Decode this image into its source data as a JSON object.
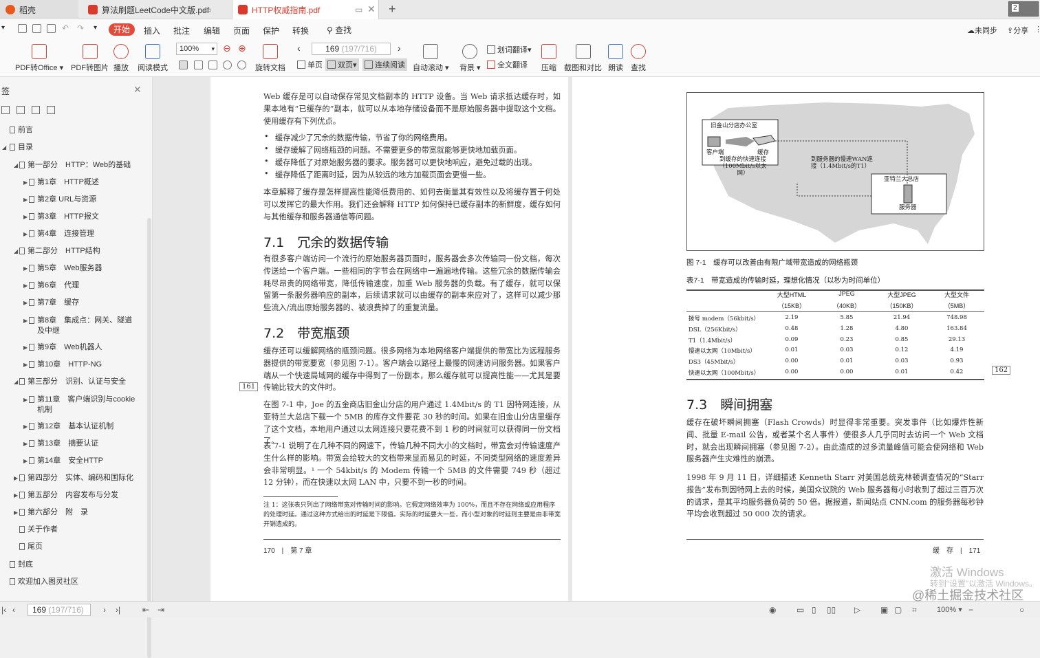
{
  "tabs": [
    {
      "label": "稻壳"
    },
    {
      "label": "算法刷题LeetCode中文版.pdf"
    },
    {
      "label": "HTTP权威指南.pdf"
    }
  ],
  "thumbnail_badge": "2",
  "menu": {
    "start": "开始",
    "items": [
      "插入",
      "批注",
      "编辑",
      "页面",
      "保护",
      "转换"
    ],
    "search": "查找",
    "sync": "未同步",
    "share": "分享"
  },
  "ribbon": {
    "pdf_to_office": "PDF转Office",
    "pdf_to_image": "PDF转图片",
    "play": "播放",
    "reading_mode": "阅读模式",
    "zoom": "100%",
    "rotate": "旋转文档",
    "page_current": "169",
    "page_total": "(197/716)",
    "single": "单页",
    "double": "双页",
    "continuous": "连续阅读",
    "auto_scroll": "自动滚动",
    "background": "背景",
    "word_translate": "划词翻译",
    "full_translate": "全文翻译",
    "compress": "压缩",
    "screenshot_compare": "截图和对比",
    "read_aloud": "朗读",
    "find": "查找"
  },
  "sidebar": {
    "title": "签",
    "toc": [
      {
        "label": "前言",
        "level": 0
      },
      {
        "label": "目录",
        "level": 0
      },
      {
        "label": "第一部分　HTTP：Web的基础",
        "level": 1
      },
      {
        "label": "第1章　HTTP概述",
        "level": 2
      },
      {
        "label": "第2章 URL与资源",
        "level": 2
      },
      {
        "label": "第3章　HTTP报文",
        "level": 2
      },
      {
        "label": "第4章　连接管理",
        "level": 2
      },
      {
        "label": "第二部分　HTTP结构",
        "level": 1
      },
      {
        "label": "第5章　Web服务器",
        "level": 2
      },
      {
        "label": "第6章　代理",
        "level": 2
      },
      {
        "label": "第7章　缓存",
        "level": 2
      },
      {
        "label": "第8章　集成点：网关、隧道及中继",
        "level": 2
      },
      {
        "label": "第9章　Web机器人",
        "level": 2
      },
      {
        "label": "第10章　HTTP-NG",
        "level": 2
      },
      {
        "label": "第三部分　识别、认证与安全",
        "level": 1
      },
      {
        "label": "第11章　客户端识别与cookie机制",
        "level": 2
      },
      {
        "label": "第12章　基本认证机制",
        "level": 2
      },
      {
        "label": "第13章　摘要认证",
        "level": 2
      },
      {
        "label": "第14章　安全HTTP",
        "level": 2
      },
      {
        "label": "第四部分　实体、编码和国际化",
        "level": 1
      },
      {
        "label": "第五部分　内容发布与分发",
        "level": 1
      },
      {
        "label": "第六部分　附　录",
        "level": 1
      },
      {
        "label": "关于作者",
        "level": 1
      },
      {
        "label": "尾页",
        "level": 1
      },
      {
        "label": "封底",
        "level": 0
      },
      {
        "label": "欢迎加入图灵社区",
        "level": 0
      }
    ]
  },
  "left_page": {
    "intro": "Web 缓存是可以自动保存常见文档副本的 HTTP 设备。当 Web 请求抵达缓存时，如果本地有“已缓存的”副本，就可以从本地存储设备而不是原始服务器中提取这个文档。使用缓存有下列优点。",
    "bullets": [
      "缓存减少了冗余的数据传输，节省了你的网络费用。",
      "缓存缓解了网络瓶颈的问题。不需要更多的带宽就能够更快地加载页面。",
      "缓存降低了对原始服务器的要求。服务器可以更快地响应，避免过载的出现。",
      "缓存降低了距离时延，因为从较远的地方加载页面会更慢一些。"
    ],
    "para2": "本章解释了缓存是怎样提高性能降低费用的、如何去衡量其有效性以及将缓存置于何处可以发挥它的最大作用。我们还会解释 HTTP 如何保持已缓存副本的新鲜度，缓存如何与其他缓存和服务器通信等问题。",
    "h71": "7.1　冗余的数据传输",
    "para3": "有很多客户端访问一个流行的原始服务器页面时，服务器会多次传输同一份文档，每次传送给一个客户端。一些相同的字节会在网络中一遍遍地传输。这些冗余的数据传输会耗尽昂贵的网络带宽，降低传输速度，加重 Web 服务器的负载。有了缓存，就可以保留第一条服务器响应的副本，后续请求就可以由缓存的副本来应对了，这样可以减少那些流入/流出原始服务器的、被浪费掉了的重复流量。",
    "h72": "7.2　带宽瓶颈",
    "para4": "缓存还可以缓解网络的瓶颈问题。很多网络为本地网络客户端提供的带宽比为远程服务器提供的带宽要宽（参见图 7-1）。客户端会以路径上最慢的网速访问服务器。如果客户端从一个快速局域网的缓存中得到了一份副本，那么缓存就可以提高性能——尤其是要传输比较大的文件时。",
    "margin": "161",
    "para5": "在图 7-1 中，Joe 的五金商店旧金山分店的用户通过 1.4Mbit/s 的 T1 因特网连接，从亚特兰大总店下载一个 5MB 的库存文件要花 30 秒的时间。如果在旧金山分店里缓存了这个文档，本地用户通过以太网连接只要花费不到 1 秒的时间就可以获得同一份文档了。",
    "para6": "表 7-1 说明了在几种不同的网速下，传输几种不同大小的文档时，带宽会对传输速度产生什么样的影响。带宽会给较大的文档带来显而易见的时延，不同类型网络的速度差异会非常明显。¹ 一个 54kbit/s 的 Modem 传输一个 5MB 的文件需要 749 秒（超过 12 分钟），而在快速以太网 LAN 中，只要不到一秒的时间。",
    "footnote": "注 1：这张表只列出了网络带宽对传输时间的影响。它假定网络效率为 100%，而且不存在网络或应用程序的处理时延。通过这种方式给出的时延是下限值。实际的时延要大一些，而小型对象的时延则主要是由非带宽开销造成的。",
    "footer": "170　|　第 7 章"
  },
  "right_page": {
    "figure_labels": {
      "sf_office": "旧金山分店办公室",
      "client": "客户端",
      "cache": "缓存",
      "fast_link": "到缓存的快速连接（100Mbit/s以太网）",
      "wan": "到服务器的慢速WAN连接（1.4Mbit/s的T1）",
      "hq": "亚特兰大总店",
      "server": "服务器"
    },
    "figure_caption": "图 7-1　缓存可以改善由有限广域带宽造成的网络瓶颈",
    "table_caption": "表7-1　带宽造成的传输时延，理想化情况（以秒为时间单位）",
    "table": {
      "headers": [
        {
          "name": "大型HTML",
          "size": "（15KB）"
        },
        {
          "name": "JPEG",
          "size": "（40KB）"
        },
        {
          "name": "大型JPEG",
          "size": "（150KB）"
        },
        {
          "name": "大型文件",
          "size": "（5MB）"
        }
      ],
      "rows": [
        {
          "label": "拨号 modem（56kbit/s）",
          "values": [
            "2.19",
            "5.85",
            "21.94",
            "748.98"
          ]
        },
        {
          "label": "DSL（256Kbit/s）",
          "values": [
            "0.48",
            "1.28",
            "4.80",
            "163.84"
          ]
        },
        {
          "label": "T1（1.4Mbit/s）",
          "values": [
            "0.09",
            "0.23",
            "0.85",
            "29.13"
          ]
        },
        {
          "label": "慢速以太网（10Mbit/s）",
          "values": [
            "0.01",
            "0.03",
            "0.12",
            "4.19"
          ]
        },
        {
          "label": "DS3（45Mbit/s）",
          "values": [
            "0.00",
            "0.01",
            "0.03",
            "0.93"
          ]
        },
        {
          "label": "快速以太网（100Mbit/s）",
          "values": [
            "0.00",
            "0.00",
            "0.01",
            "0.42"
          ]
        }
      ]
    },
    "margin": "162",
    "h73": "7.3　瞬间拥塞",
    "para1": "缓存在破坏瞬间拥塞（Flash Crowds）时显得非常重要。突发事件（比如爆炸性新闻、批量 E-mail 公告，或者某个名人事件）使很多人几乎同时去访问一个 Web 文档时，就会出现瞬间拥塞（参见图 7-2）。由此造成的过多流量峰值可能会使网络和 Web 服务器产生灾难性的崩溃。",
    "para2": "1998 年 9 月 11 日，详细描述 Kenneth Starr 对美国总统克林顿调查情况的“Starr 报告”发布到因特网上去的时候，美国众议院的 Web 服务器每小时收到了超过三百万次的请求，是其平均服务器负荷的 50 倍。据报道，新闻站点 CNN.com 的服务器每秒钟平均会收到超过 50 000 次的请求。",
    "footer": "缓　存　|　171"
  },
  "status": {
    "page_current": "169",
    "page_total": "(197/716)",
    "zoom": "100%"
  },
  "watermark": {
    "line1": "激活 Windows",
    "line2": "转到“设置”以激活 Windows。",
    "line3": "@稀土掘金技术社区"
  }
}
